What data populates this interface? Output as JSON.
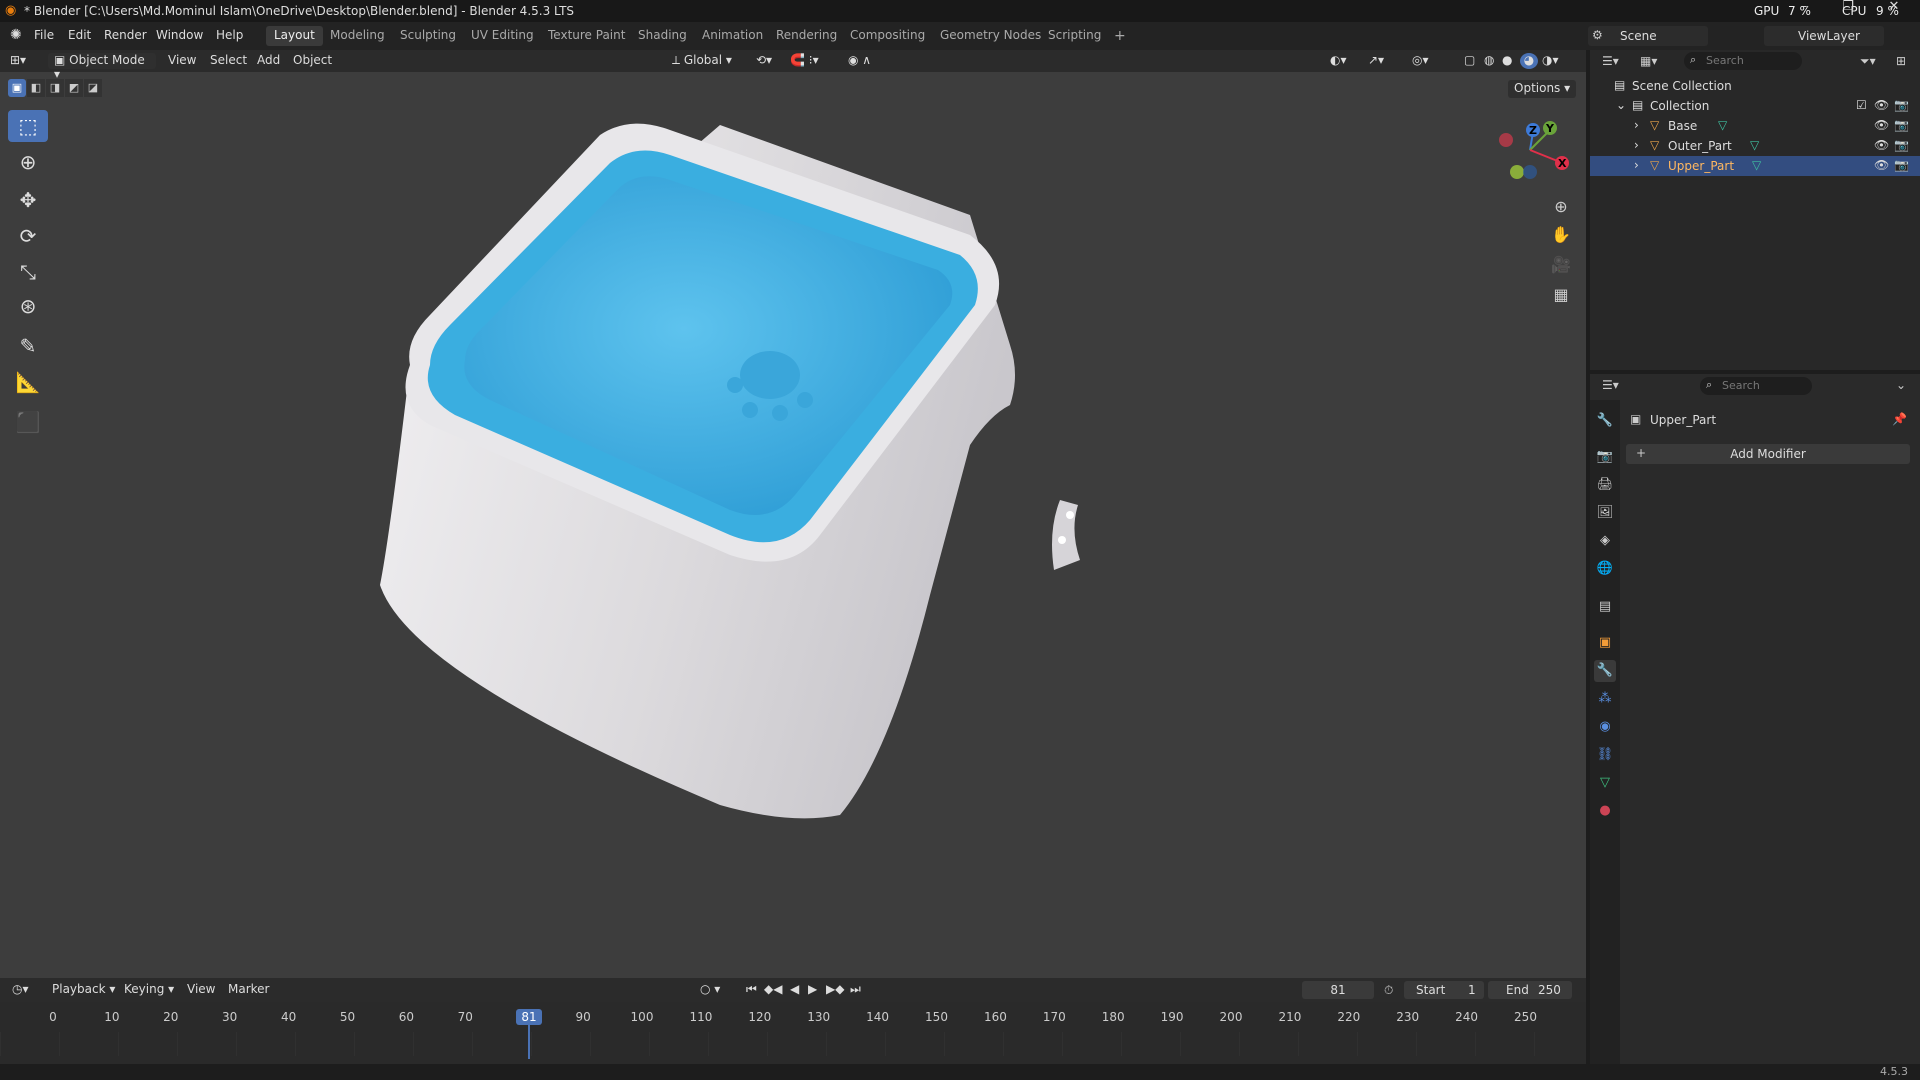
{
  "window": {
    "title": "* Blender [C:\\Users\\Md.Mominul Islam\\OneDrive\\Desktop\\Blender.blend] - Blender 4.5.3 LTS",
    "gpu_label": "GPU",
    "gpu_value": "7 %",
    "cpu_label": "CPU",
    "cpu_value": "9 %"
  },
  "menu": {
    "items": [
      "File",
      "Edit",
      "Render",
      "Window",
      "Help"
    ],
    "workspaces": [
      "Layout",
      "Modeling",
      "Sculpting",
      "UV Editing",
      "Texture Paint",
      "Shading",
      "Animation",
      "Rendering",
      "Compositing",
      "Geometry Nodes",
      "Scripting"
    ],
    "active_workspace": "Layout",
    "add_tab": "+",
    "scene": "Scene",
    "view_layer": "ViewLayer"
  },
  "viewport_header": {
    "mode": "Object Mode",
    "menus": [
      "View",
      "Select",
      "Add",
      "Object"
    ],
    "orientation": "Global",
    "options": "Options"
  },
  "tools": [
    "select-box-icon",
    "cursor-icon",
    "move-icon",
    "rotate-icon",
    "scale-icon",
    "transform-icon",
    "annotate-icon",
    "measure-icon",
    "add-cube-icon"
  ],
  "gizmo": {
    "x": "X",
    "y": "Y",
    "z": "Z"
  },
  "outliner": {
    "search_placeholder": "Search",
    "root": "Scene Collection",
    "collection": "Collection",
    "objects": [
      "Base",
      "Outer_Part",
      "Upper_Part"
    ],
    "selected": "Upper_Part"
  },
  "properties": {
    "search_placeholder": "Search",
    "object_name": "Upper_Part",
    "add_modifier": "Add Modifier"
  },
  "timeline": {
    "menus": [
      "Playback",
      "Keying",
      "View",
      "Marker"
    ],
    "current_frame": "81",
    "start_label": "Start",
    "start": "1",
    "end_label": "End",
    "end": "250",
    "ticks": [
      "0",
      "10",
      "20",
      "30",
      "40",
      "50",
      "60",
      "70",
      "81",
      "90",
      "100",
      "110",
      "120",
      "130",
      "140",
      "150",
      "160",
      "170",
      "180",
      "190",
      "200",
      "210",
      "220",
      "230",
      "240",
      "250"
    ]
  },
  "status": {
    "version": "4.5.3"
  },
  "colors": {
    "accent": "#4a72b5",
    "water": "#4fb3e0",
    "bowl": "#e3e1e3",
    "viewport": "#3d3d3d"
  }
}
